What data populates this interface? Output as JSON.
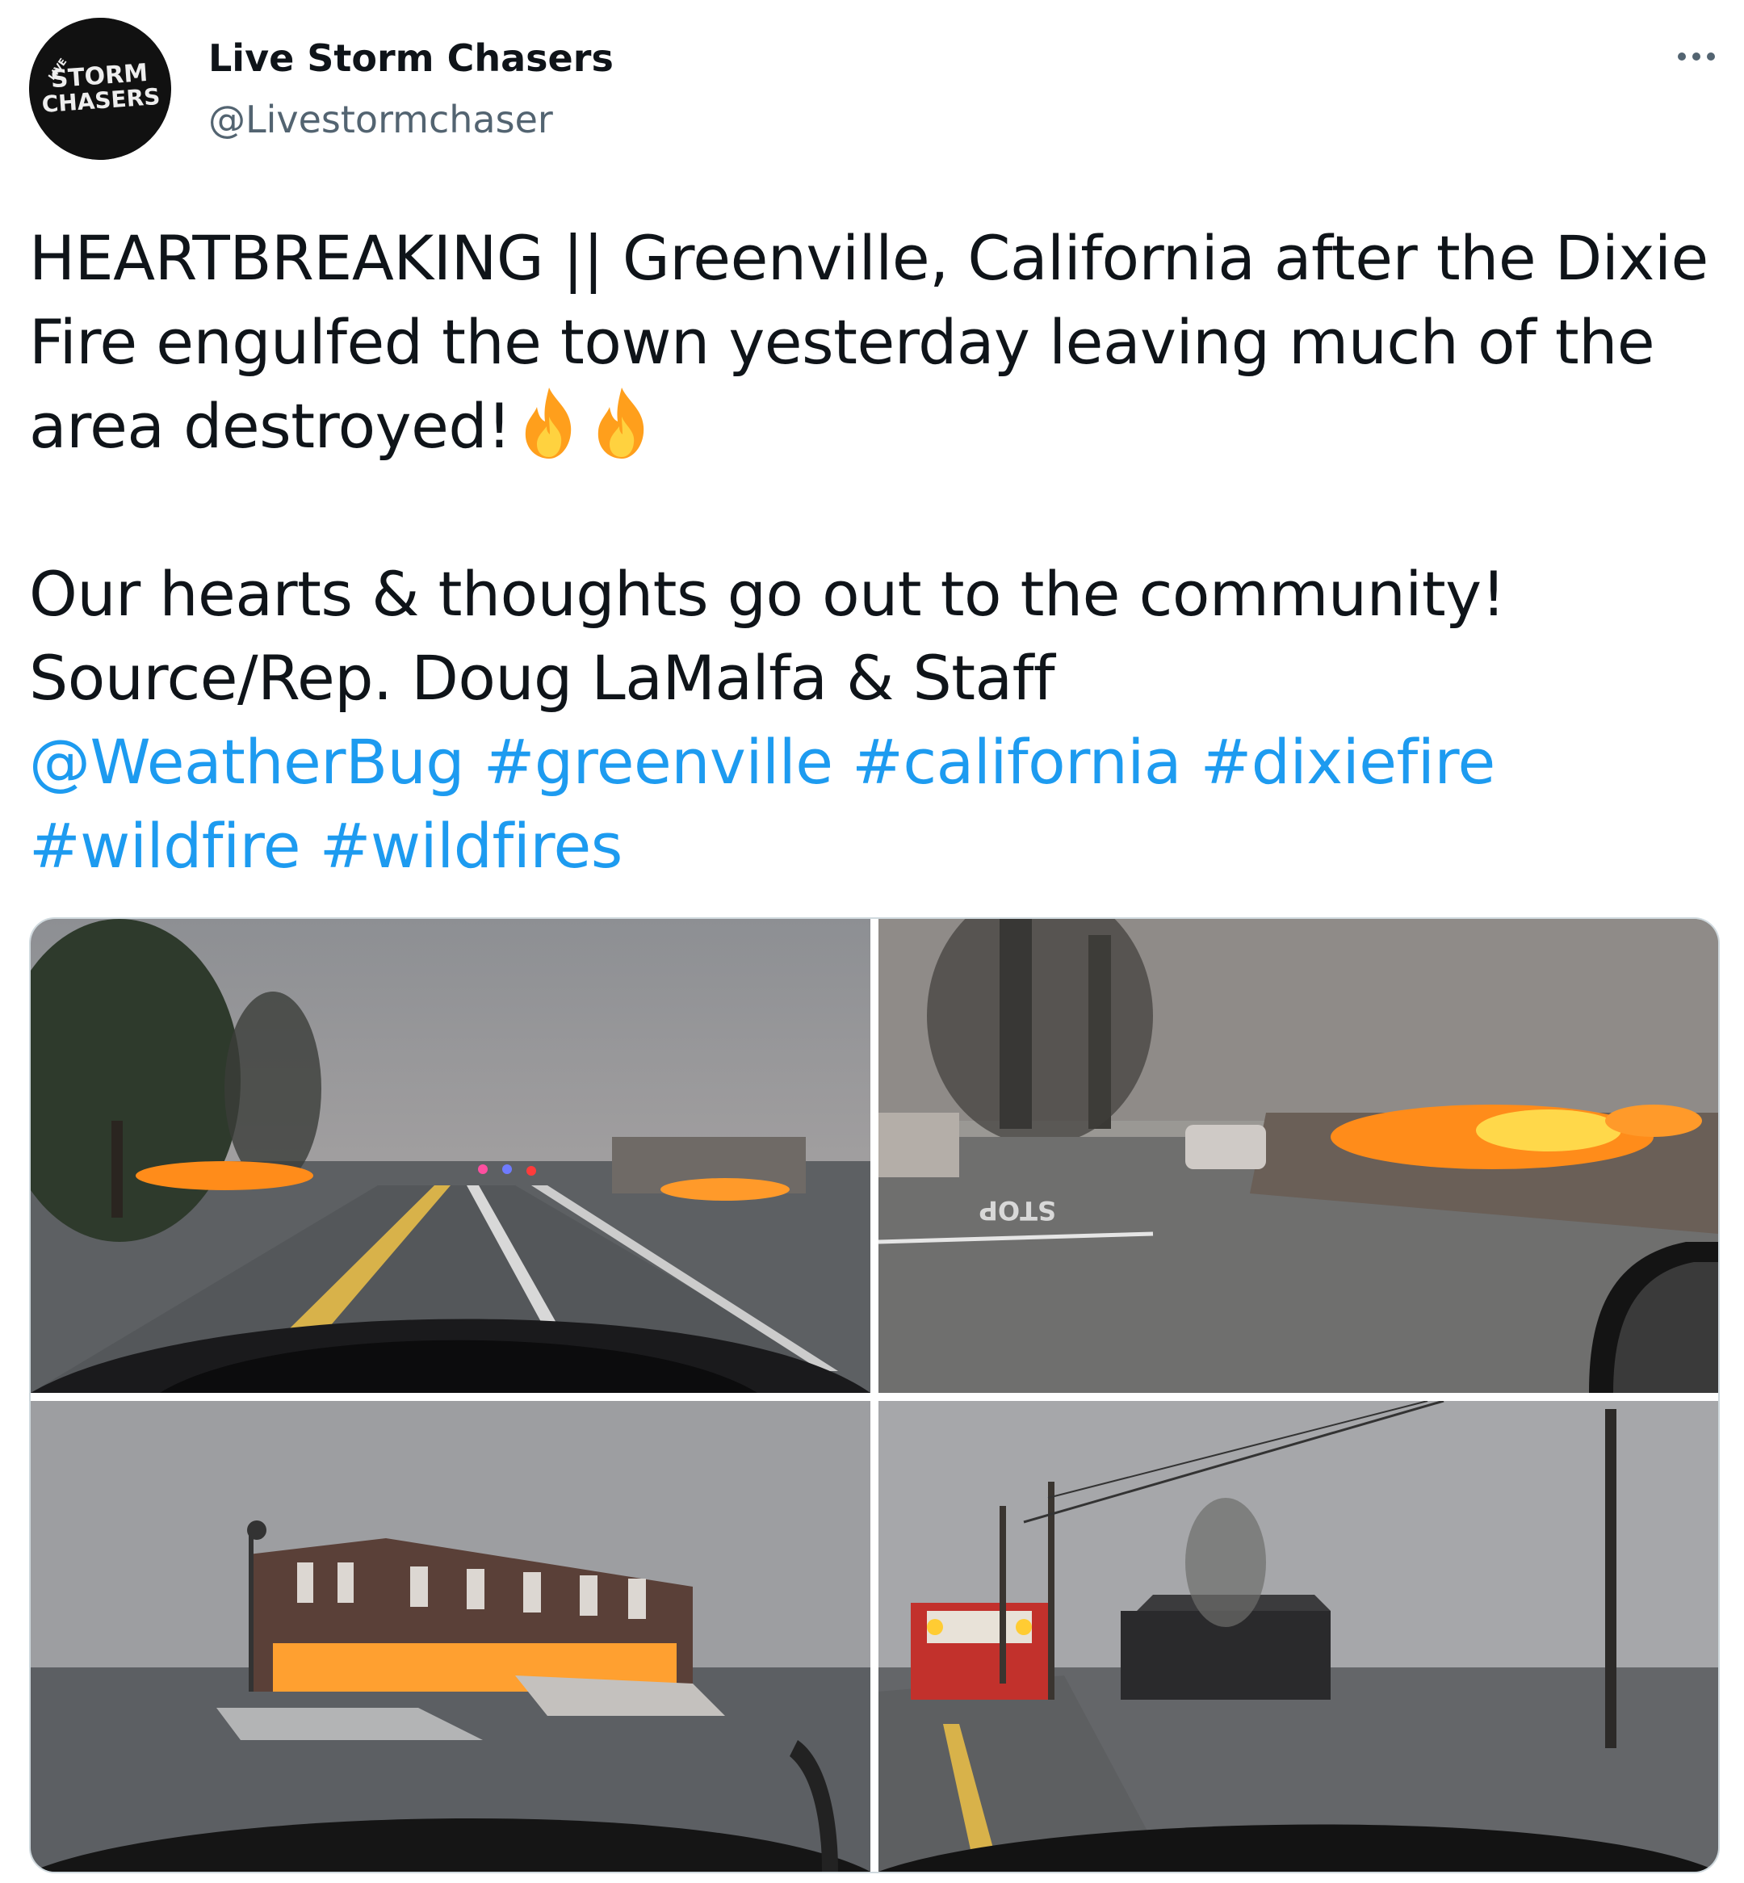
{
  "author": {
    "name": "Live Storm Chasers",
    "handle": "@Livestormchaser",
    "avatar_text_top": "STORM",
    "avatar_text_bottom": "CHASERS",
    "avatar_text_side": "LIVE"
  },
  "menu": {
    "icon": "more-dots-icon"
  },
  "tweet": {
    "line1": "HEARTBREAKING || Greenville, California after the Dixie",
    "line2": "Fire engulfed the town yesterday leaving much of the",
    "line3": "area destroyed!",
    "line3_emoji": "fire-emoji",
    "line4": "Our hearts & thoughts go out to the community!",
    "line5": "Source/Rep. Doug LaMalfa & Staff",
    "mention": "@WeatherBug",
    "hashtags": [
      "#greenville",
      "#california",
      "#dixiefire",
      "#wildfire",
      "#wildfires"
    ]
  },
  "media": {
    "photos": [
      {
        "label": "photo-1-burning-main-street",
        "road_marking": ""
      },
      {
        "label": "photo-2-burning-debris-intersection",
        "road_marking": "STOP"
      },
      {
        "label": "photo-3-burned-brick-building",
        "road_marking": ""
      },
      {
        "label": "photo-4-fire-truck-on-road",
        "road_marking": ""
      }
    ]
  },
  "colors": {
    "link": "#1d9bf0",
    "text": "#0f1419",
    "secondary": "#536471",
    "border": "#cfd9de",
    "fire": "#ff8c1a"
  }
}
